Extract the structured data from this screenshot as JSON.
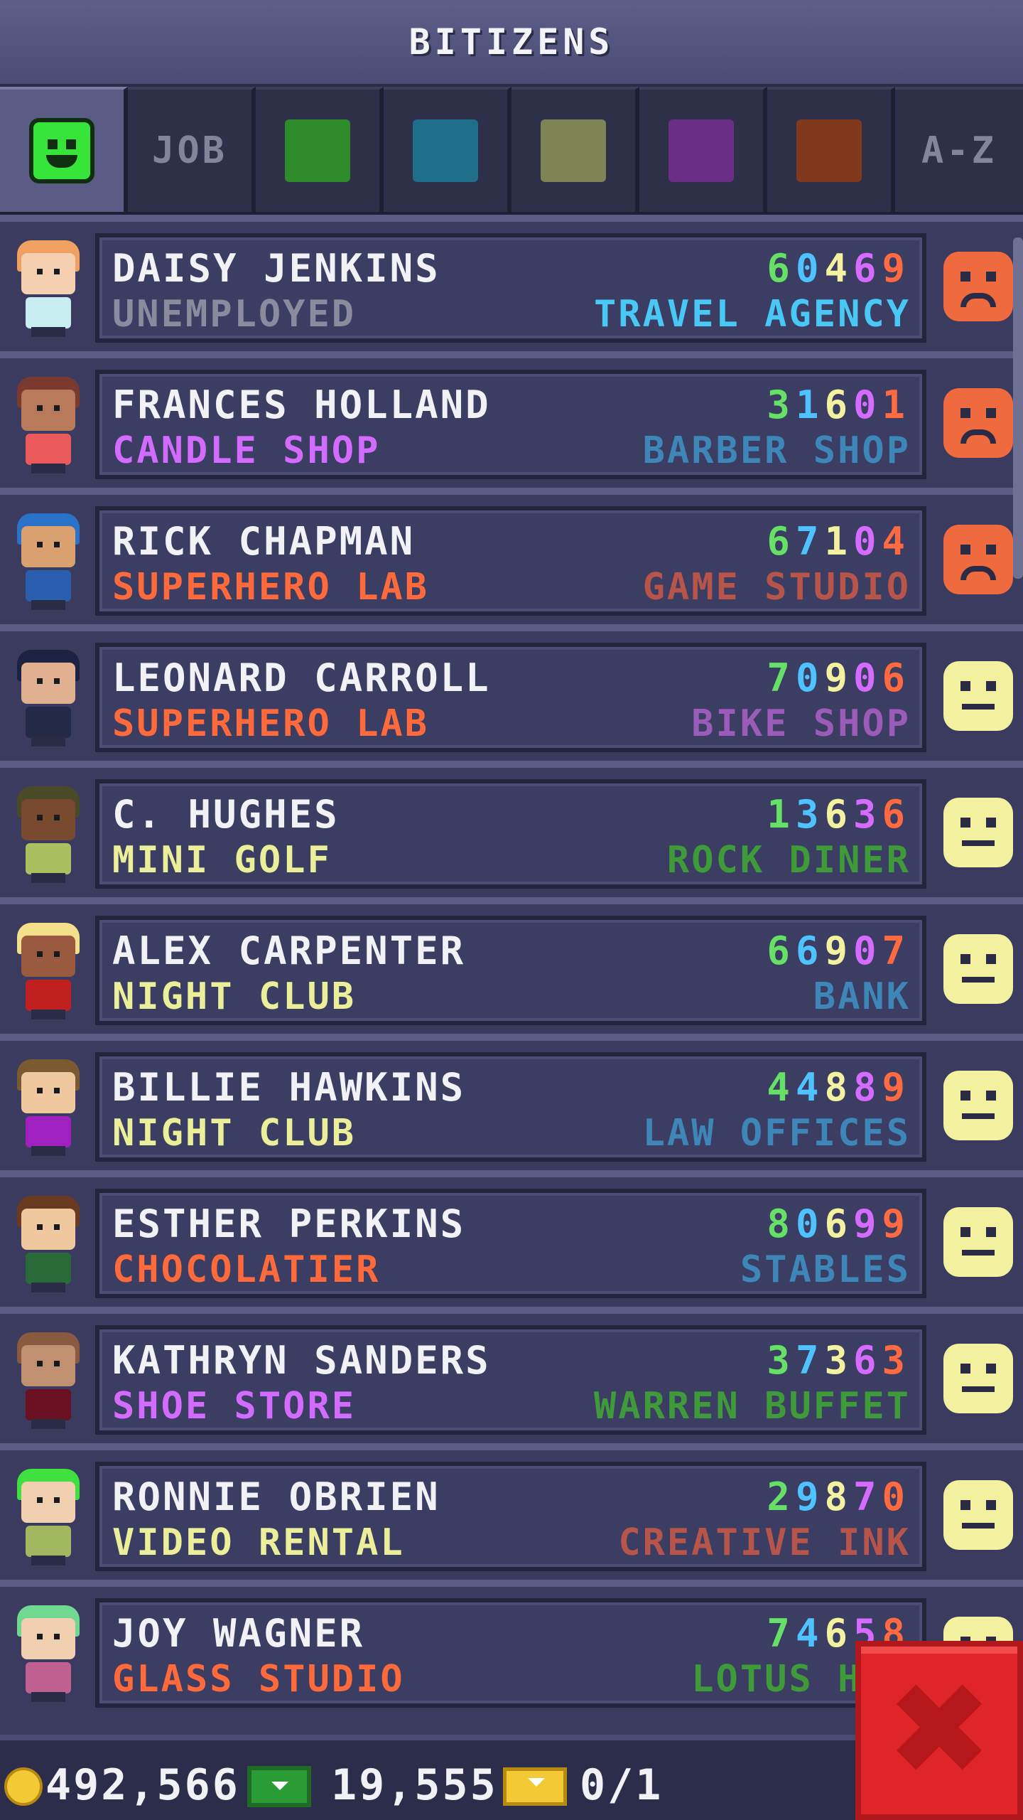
{
  "header": {
    "title": "BITIZENS"
  },
  "tabs": [
    {
      "type": "smiley",
      "color": "#37e53a",
      "icon": "happy-face-icon",
      "active": true
    },
    {
      "type": "label",
      "label": "JOB"
    },
    {
      "type": "swatch",
      "color": "#2e8b2a",
      "icon": "green-category-swatch"
    },
    {
      "type": "swatch",
      "color": "#1f6f8a",
      "icon": "blue-category-swatch"
    },
    {
      "type": "swatch",
      "color": "#7e8455",
      "icon": "olive-category-swatch"
    },
    {
      "type": "swatch",
      "color": "#6c2f88",
      "icon": "purple-category-swatch"
    },
    {
      "type": "swatch",
      "color": "#80391c",
      "icon": "brown-category-swatch"
    },
    {
      "type": "label",
      "label": "A-Z"
    }
  ],
  "skill_colors": [
    "#66e066",
    "#4fc3ff",
    "#f2f2a0",
    "#d66bff",
    "#ff6a40"
  ],
  "bitizens": [
    {
      "name": "DAISY JENKINS",
      "skills": [
        "6",
        "0",
        "4",
        "6",
        "9"
      ],
      "job": "UNEMPLOYED",
      "job_color": "#8a8b9e",
      "dream": "TRAVEL AGENCY",
      "dream_color": "#49c8f5",
      "mood": "sad",
      "hair": "#f0a060",
      "skin": "#f5d0b0",
      "shirt": "#c8eef2"
    },
    {
      "name": "FRANCES HOLLAND",
      "skills": [
        "3",
        "1",
        "6",
        "0",
        "1"
      ],
      "job": "CANDLE SHOP",
      "job_color": "#d46bff",
      "dream": "BARBER SHOP",
      "dream_color": "#3f86b8",
      "mood": "sad",
      "hair": "#7a3a30",
      "skin": "#b87a5a",
      "shirt": "#ea5a5a"
    },
    {
      "name": "RICK CHAPMAN",
      "skills": [
        "6",
        "7",
        "1",
        "0",
        "4"
      ],
      "job": "SUPERHERO LAB",
      "job_color": "#ff6a3c",
      "dream": "GAME STUDIO",
      "dream_color": "#b8554a",
      "mood": "sad",
      "hair": "#2a72c8",
      "skin": "#d9a070",
      "shirt": "#2a5fb0"
    },
    {
      "name": "LEONARD CARROLL",
      "skills": [
        "7",
        "0",
        "9",
        "0",
        "6"
      ],
      "job": "SUPERHERO LAB",
      "job_color": "#ff6a3c",
      "dream": "BIKE SHOP",
      "dream_color": "#9b5bb8",
      "mood": "neutral",
      "hair": "#1c2340",
      "skin": "#e0b090",
      "shirt": "#222a48"
    },
    {
      "name": "C. HUGHES",
      "skills": [
        "1",
        "3",
        "6",
        "3",
        "6"
      ],
      "job": "MINI GOLF",
      "job_color": "#ecef9a",
      "dream": "ROCK DINER",
      "dream_color": "#3f9a3a",
      "mood": "neutral",
      "hair": "#4a4a28",
      "skin": "#7a4a30",
      "shirt": "#a8c060"
    },
    {
      "name": "ALEX CARPENTER",
      "skills": [
        "6",
        "6",
        "9",
        "0",
        "7"
      ],
      "job": "NIGHT CLUB",
      "job_color": "#ecef9a",
      "dream": "BANK",
      "dream_color": "#3f86b8",
      "mood": "neutral",
      "hair": "#f4e08a",
      "skin": "#9a5a40",
      "shirt": "#c02020"
    },
    {
      "name": "BILLIE HAWKINS",
      "skills": [
        "4",
        "4",
        "8",
        "8",
        "9"
      ],
      "job": "NIGHT CLUB",
      "job_color": "#ecef9a",
      "dream": "LAW OFFICES",
      "dream_color": "#3f86b8",
      "mood": "neutral",
      "hair": "#7a5a30",
      "skin": "#f0c8a0",
      "shirt": "#a020c0"
    },
    {
      "name": "ESTHER PERKINS",
      "skills": [
        "8",
        "0",
        "6",
        "9",
        "9"
      ],
      "job": "CHOCOLATIER",
      "job_color": "#ff6a3c",
      "dream": "STABLES",
      "dream_color": "#3f86b8",
      "mood": "neutral",
      "hair": "#6a3a20",
      "skin": "#f0c8a0",
      "shirt": "#2a6a38"
    },
    {
      "name": "KATHRYN SANDERS",
      "skills": [
        "3",
        "7",
        "3",
        "6",
        "3"
      ],
      "job": "SHOE STORE",
      "job_color": "#d46bff",
      "dream": "WARREN BUFFET",
      "dream_color": "#3f9a3a",
      "mood": "neutral",
      "hair": "#8a5a40",
      "skin": "#c09070",
      "shirt": "#6a1020"
    },
    {
      "name": "RONNIE OBRIEN",
      "skills": [
        "2",
        "9",
        "8",
        "7",
        "0"
      ],
      "job": "VIDEO RENTAL",
      "job_color": "#ecef9a",
      "dream": "CREATIVE INK",
      "dream_color": "#b8554a",
      "mood": "neutral",
      "hair": "#40e040",
      "skin": "#f0d0b0",
      "shirt": "#a0b860"
    },
    {
      "name": "JOY WAGNER",
      "skills": [
        "7",
        "4",
        "6",
        "5",
        "8"
      ],
      "job": "GLASS STUDIO",
      "job_color": "#ff6a3c",
      "dream": "LOTUS HOU",
      "dream_color": "#3f9a3a",
      "mood": "neutral",
      "hair": "#70d890",
      "skin": "#f0d0b0",
      "shirt": "#c06090"
    }
  ],
  "mood_colors": {
    "sad": "#f06a40",
    "neutral": "#f3f0a0"
  },
  "footer": {
    "coins": "492,566",
    "bux": "19,555",
    "tickets": "0/1"
  },
  "close_button": {
    "label": "✖"
  }
}
